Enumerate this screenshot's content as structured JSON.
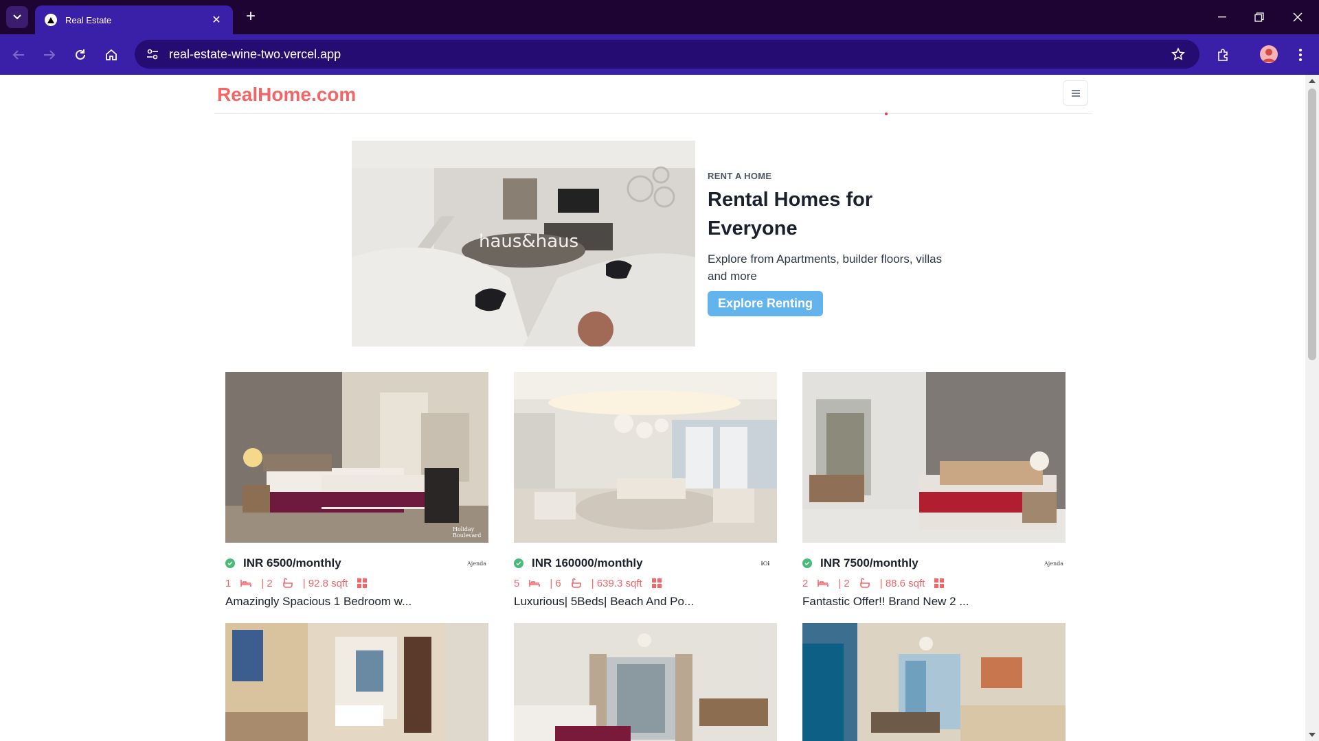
{
  "browser": {
    "tab_title": "Real Estate",
    "url": "real-estate-wine-two.vercel.app"
  },
  "site": {
    "logo": "RealHome.com"
  },
  "hero": {
    "kicker": "RENT A HOME",
    "title": "Rental Homes for Everyone",
    "description": "Explore from Apartments, builder floors, villas and more",
    "button": "Explore Renting",
    "image_watermark": "haus&haus"
  },
  "listings": [
    {
      "price": "INR 6500/monthly",
      "rooms": "1",
      "baths": "| 2",
      "area": "| 92.8 sqft",
      "title": "Amazingly Spacious 1 Bedroom w...",
      "agency": "Ajenda",
      "image_label": "Holiday Boulevard"
    },
    {
      "price": "INR 160000/monthly",
      "rooms": "5",
      "baths": "| 6",
      "area": "| 639.3 sqft",
      "title": "Luxurious| 5Beds| Beach And Po...",
      "agency": "ℹOℹ",
      "image_label": ""
    },
    {
      "price": "INR 7500/monthly",
      "rooms": "2",
      "baths": "| 2",
      "area": "| 88.6 sqft",
      "title": "Fantastic Offer!! Brand New 2 ...",
      "agency": "Ajenda",
      "image_label": ""
    }
  ],
  "colors": {
    "accent": "#f56565",
    "button": "#63b3ed",
    "verified": "#48bb78",
    "browser_bar": "#3a1fa8",
    "tab_strip": "#1d0433"
  }
}
